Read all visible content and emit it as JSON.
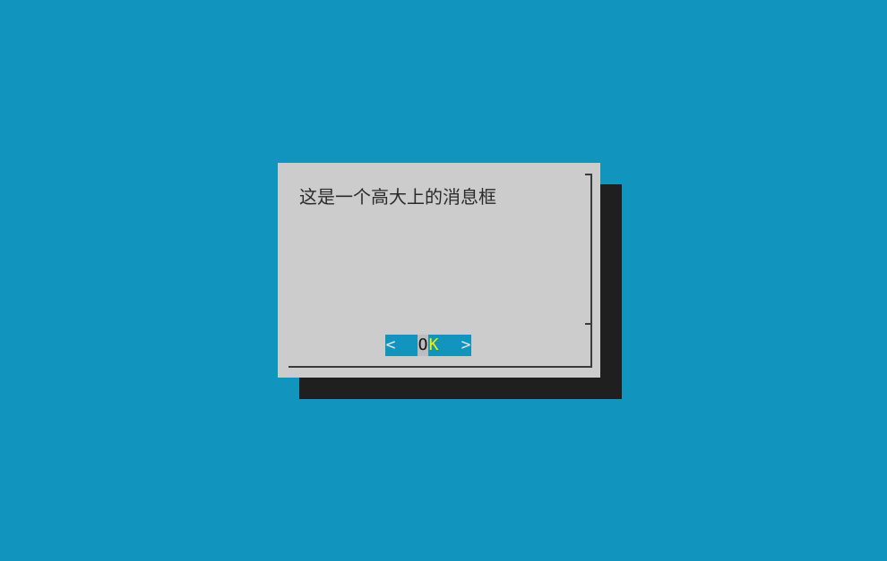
{
  "dialog": {
    "message": "这是一个高大上的消息框",
    "button": {
      "left_bracket": "<",
      "hotkey_char": "O",
      "rest_chars": "K",
      "right_bracket": ">"
    }
  },
  "colors": {
    "background": "#1195bf",
    "dialog": "#cccccc",
    "shadow": "#1f1f1f",
    "button_bg": "#1195bf",
    "button_hotkey_bg": "#bdbdbd",
    "button_highlight_text": "#f5f000"
  }
}
